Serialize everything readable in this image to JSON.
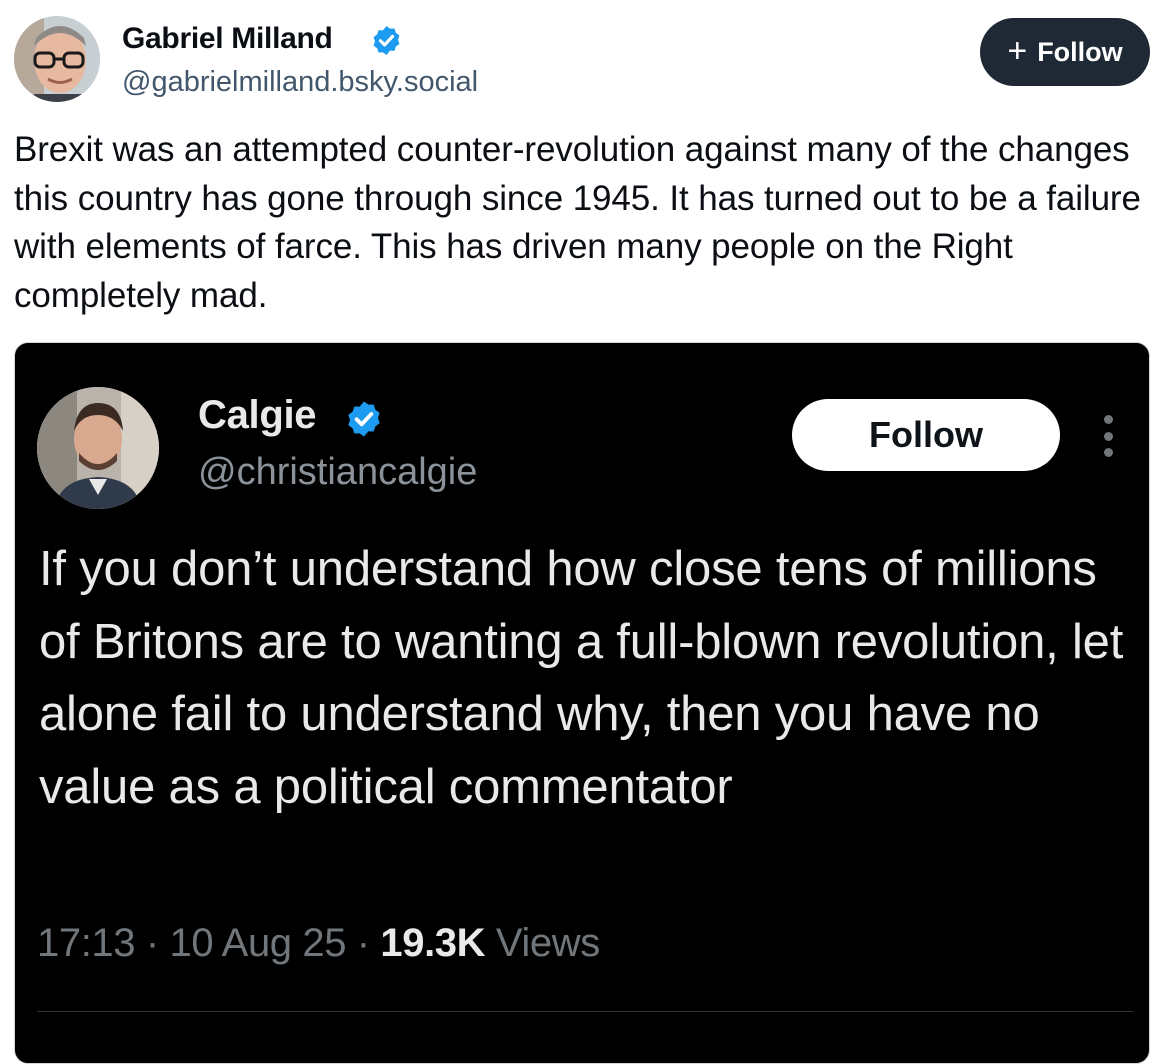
{
  "author": {
    "name": "Gabriel Milland",
    "handle": "@gabrielmilland.bsky.social",
    "verified": true,
    "avatar_icon": "person-with-glasses-avatar"
  },
  "follow_button": {
    "label": "Follow",
    "icon": "plus-icon"
  },
  "post": {
    "text": "Brexit was an attempted counter-revolution against many of the changes this country has gone through since 1945. It has turned out to be a failure with elements of farce. This has driven many people on the Right completely mad."
  },
  "embed": {
    "author_name": "Calgie",
    "handle": "@christiancalgie",
    "verified": true,
    "follow_label": "Follow",
    "text": "If you don’t understand how close tens of millions of Britons are to wanting a full-blown revolution, let alone fail to understand why, then you have no value as a political commentator",
    "time": "17:13",
    "separator": "·",
    "date": "10 Aug 25",
    "views_count": "19.3K",
    "views_label": "Views"
  },
  "colors": {
    "verified_blue": "#1d9bf0",
    "follow_button_dark": "#1e2935",
    "handle_gray": "#42576c",
    "embed_background": "#000000"
  }
}
